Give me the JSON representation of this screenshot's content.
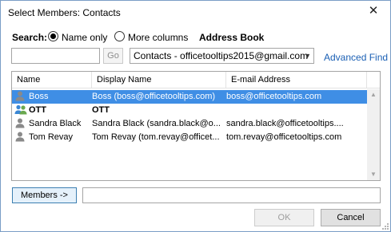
{
  "window": {
    "title": "Select Members: Contacts",
    "close_glyph": "✕"
  },
  "search": {
    "label": "Search:",
    "options": [
      {
        "label": "Name only",
        "selected": true
      },
      {
        "label": "More columns",
        "selected": false
      }
    ],
    "address_book_label": "Address Book",
    "query_value": "",
    "go_label": "Go",
    "address_book_value": "Contacts - officetooltips2015@gmail.com",
    "advanced_find_label": "Advanced Find"
  },
  "list": {
    "columns": [
      "Name",
      "Display Name",
      "E-mail Address"
    ],
    "rows": [
      {
        "icon": "contact-icon",
        "name": "Boss",
        "display": "Boss (boss@officetooltips.com)",
        "email": "boss@officetooltips.com",
        "selected": true,
        "bold": false
      },
      {
        "icon": "contact-group-icon",
        "name": "OTT",
        "display": "OTT",
        "email": "",
        "selected": false,
        "bold": true
      },
      {
        "icon": "contact-icon",
        "name": "Sandra Black",
        "display": "Sandra Black (sandra.black@o...",
        "email": "sandra.black@officetooltips....",
        "selected": false,
        "bold": false
      },
      {
        "icon": "contact-icon",
        "name": "Tom Revay",
        "display": "Tom Revay (tom.revay@officet...",
        "email": "tom.revay@officetooltips.com",
        "selected": false,
        "bold": false
      }
    ]
  },
  "members": {
    "button_label": "Members ->",
    "value": ""
  },
  "footer": {
    "ok_label": "OK",
    "cancel_label": "Cancel"
  },
  "colors": {
    "selection": "#3f8ee5",
    "link": "#1a5fb4",
    "border": "#7a9dc6"
  }
}
